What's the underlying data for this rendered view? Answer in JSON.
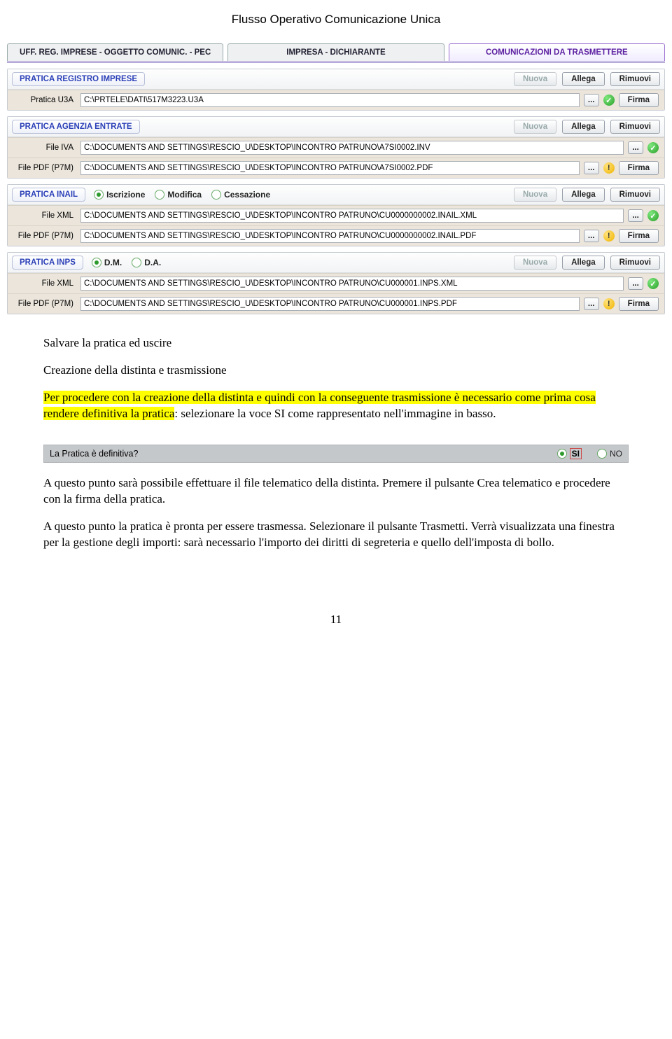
{
  "doc": {
    "header": "Flusso Operativo Comunicazione Unica",
    "page_number": "11"
  },
  "tabs": {
    "t1": "UFF. REG. IMPRESE - OGGETTO COMUNIC. - PEC",
    "t2": "IMPRESA - DICHIARANTE",
    "t3": "COMUNICAZIONI DA TRASMETTERE"
  },
  "buttons": {
    "nuova": "Nuova",
    "allega": "Allega",
    "rimuovi": "Rimuovi",
    "firma": "Firma",
    "browse": "..."
  },
  "panels": {
    "ri": {
      "title": "PRATICA REGISTRO IMPRESE",
      "row1_label": "Pratica U3A",
      "row1_value": "C:\\PRTELE\\DATI\\517M3223.U3A"
    },
    "ae": {
      "title": "PRATICA AGENZIA ENTRATE",
      "row1_label": "File IVA",
      "row1_value": "C:\\DOCUMENTS AND SETTINGS\\RESCIO_U\\DESKTOP\\INCONTRO PATRUNO\\A7SI0002.INV",
      "row2_label": "File PDF (P7M)",
      "row2_value": "C:\\DOCUMENTS AND SETTINGS\\RESCIO_U\\DESKTOP\\INCONTRO PATRUNO\\A7SI0002.PDF"
    },
    "inail": {
      "title": "PRATICA INAIL",
      "radio1": "Iscrizione",
      "radio2": "Modifica",
      "radio3": "Cessazione",
      "row1_label": "File XML",
      "row1_value": "C:\\DOCUMENTS AND SETTINGS\\RESCIO_U\\DESKTOP\\INCONTRO PATRUNO\\CU0000000002.INAIL.XML",
      "row2_label": "File PDF (P7M)",
      "row2_value": "C:\\DOCUMENTS AND SETTINGS\\RESCIO_U\\DESKTOP\\INCONTRO PATRUNO\\CU0000000002.INAIL.PDF"
    },
    "inps": {
      "title": "PRATICA INPS",
      "radio1": "D.M.",
      "radio2": "D.A.",
      "row1_label": "File XML",
      "row1_value": "C:\\DOCUMENTS AND SETTINGS\\RESCIO_U\\DESKTOP\\INCONTRO PATRUNO\\CU000001.INPS.XML",
      "row2_label": "File PDF (P7M)",
      "row2_value": "C:\\DOCUMENTS AND SETTINGS\\RESCIO_U\\DESKTOP\\INCONTRO PATRUNO\\CU000001.INPS.PDF"
    }
  },
  "body": {
    "p1": "Salvare la pratica ed uscire",
    "p2": "Creazione della distinta e trasmissione",
    "p3a": "Per procedere con la creazione della distinta e quindi con la conseguente trasmissione è necessario come prima cosa rendere definitiva la pratica",
    "p3b": ": selezionare la voce SI come rappresentato nell'immagine in basso.",
    "p4": "A questo punto sarà possibile effettuare il file telematico della distinta. Premere il pulsante Crea telematico e procedere con la firma della pratica.",
    "p5": "A questo punto la pratica è pronta per essere trasmessa. Selezionare il pulsante Trasmetti. Verrà visualizzata una finestra per la gestione degli importi: sarà necessario l'importo dei diritti di segreteria e quello dell'imposta di bollo."
  },
  "definitiva": {
    "question": "La Pratica è definitiva?",
    "si": "SI",
    "no": "NO"
  }
}
